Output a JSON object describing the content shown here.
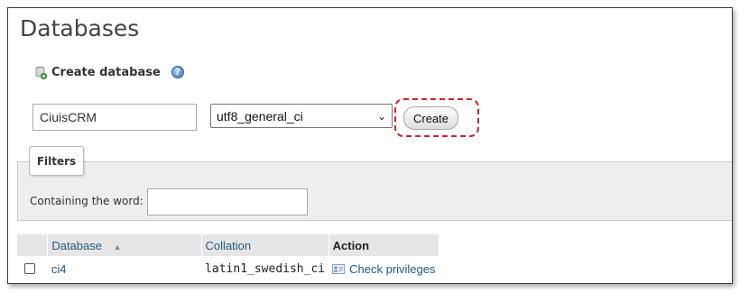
{
  "page": {
    "title": "Databases"
  },
  "create_section": {
    "heading": "Create database",
    "name_value": "CiuisCRM",
    "collation_selected": "utf8_general_ci",
    "create_label": "Create",
    "highlight_color": "#d6202a"
  },
  "filters": {
    "legend": "Filters",
    "label": "Containing the word:",
    "value": ""
  },
  "table": {
    "headers": {
      "database": "Database",
      "collation": "Collation",
      "action": "Action"
    },
    "rows": [
      {
        "database": "ci4",
        "collation": "latin1_swedish_ci",
        "action": "Check privileges"
      }
    ]
  },
  "colors": {
    "link": "#235a81",
    "filter_bg": "#eeeeee",
    "header_bg": "#e6e6e6"
  },
  "icons": {
    "db": "database-add-icon",
    "help": "help-icon",
    "sort": "sort-asc-icon",
    "privileges": "privileges-icon"
  }
}
